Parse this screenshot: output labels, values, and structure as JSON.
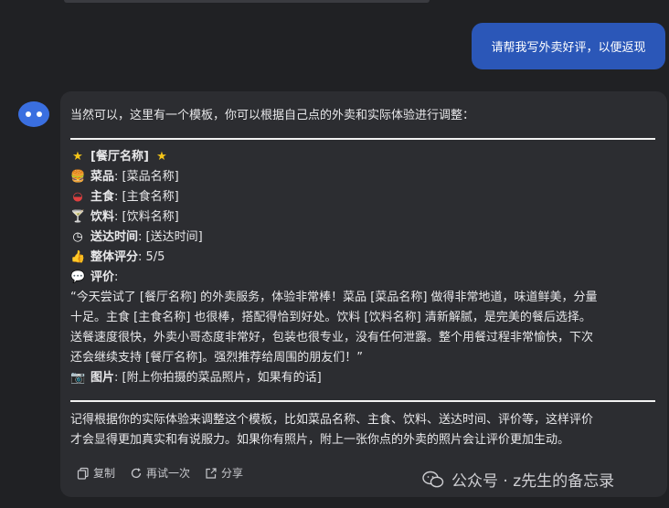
{
  "user_message": "请帮我写外卖好评，以便返现",
  "reply": {
    "intro": "当然可以，这里有一个模板，你可以根据自己点的外卖和实际体验进行调整：",
    "title": "[餐厅名称]",
    "fields": [
      {
        "label": "菜品",
        "value": ": [菜品名称]"
      },
      {
        "label": "主食",
        "value": ": [主食名称]"
      },
      {
        "label": "饮料",
        "value": ": [饮料名称]"
      },
      {
        "label": "送达时间",
        "value": ": [送达时间]"
      },
      {
        "label": "整体评分",
        "value": ": 5/5"
      },
      {
        "label": "评价",
        "value": ":"
      }
    ],
    "review_lines": [
      "“今天尝试了 [餐厅名称] 的外卖服务，体验非常棒！菜品 [菜品名称] 做得非常地道，味道鲜美，分量",
      "十足。主食 [主食名称] 也很棒，搭配得恰到好处。饮料 [饮料名称] 清新解腻，是完美的餐后选择。",
      "送餐速度很快，外卖小哥态度非常好，包装也很专业，没有任何泄露。整个用餐过程非常愉快，下次",
      "还会继续支持 [餐厅名称]。强烈推荐给周围的朋友们！”"
    ],
    "photo": {
      "label": "图片",
      "value": ": [附上你拍摄的菜品照片，如果有的话]"
    },
    "closing_lines": [
      "记得根据你的实际体验来调整这个模板，比如菜品名称、主食、饮料、送达时间、评价等，这样评价",
      "才会显得更加真实和有说服力。如果你有照片，附上一张你点的外卖的照片会让评价更加生动。"
    ]
  },
  "actions": {
    "copy": "复制",
    "retry": "再试一次",
    "share": "分享"
  },
  "watermark": "公众号 · z先生的备忘录",
  "icons": [
    "star-icon",
    "burger-icon",
    "bowl-icon",
    "cocktail-icon",
    "clock-icon",
    "thumbs-up-icon",
    "speech-icon",
    "camera-icon",
    "copy-icon",
    "retry-icon",
    "share-icon",
    "wechat-icon"
  ],
  "colors": {
    "background": "#202124",
    "card": "#2c2d31",
    "user_bubble": "#2b57b8",
    "avatar": "#3a6fe0"
  }
}
